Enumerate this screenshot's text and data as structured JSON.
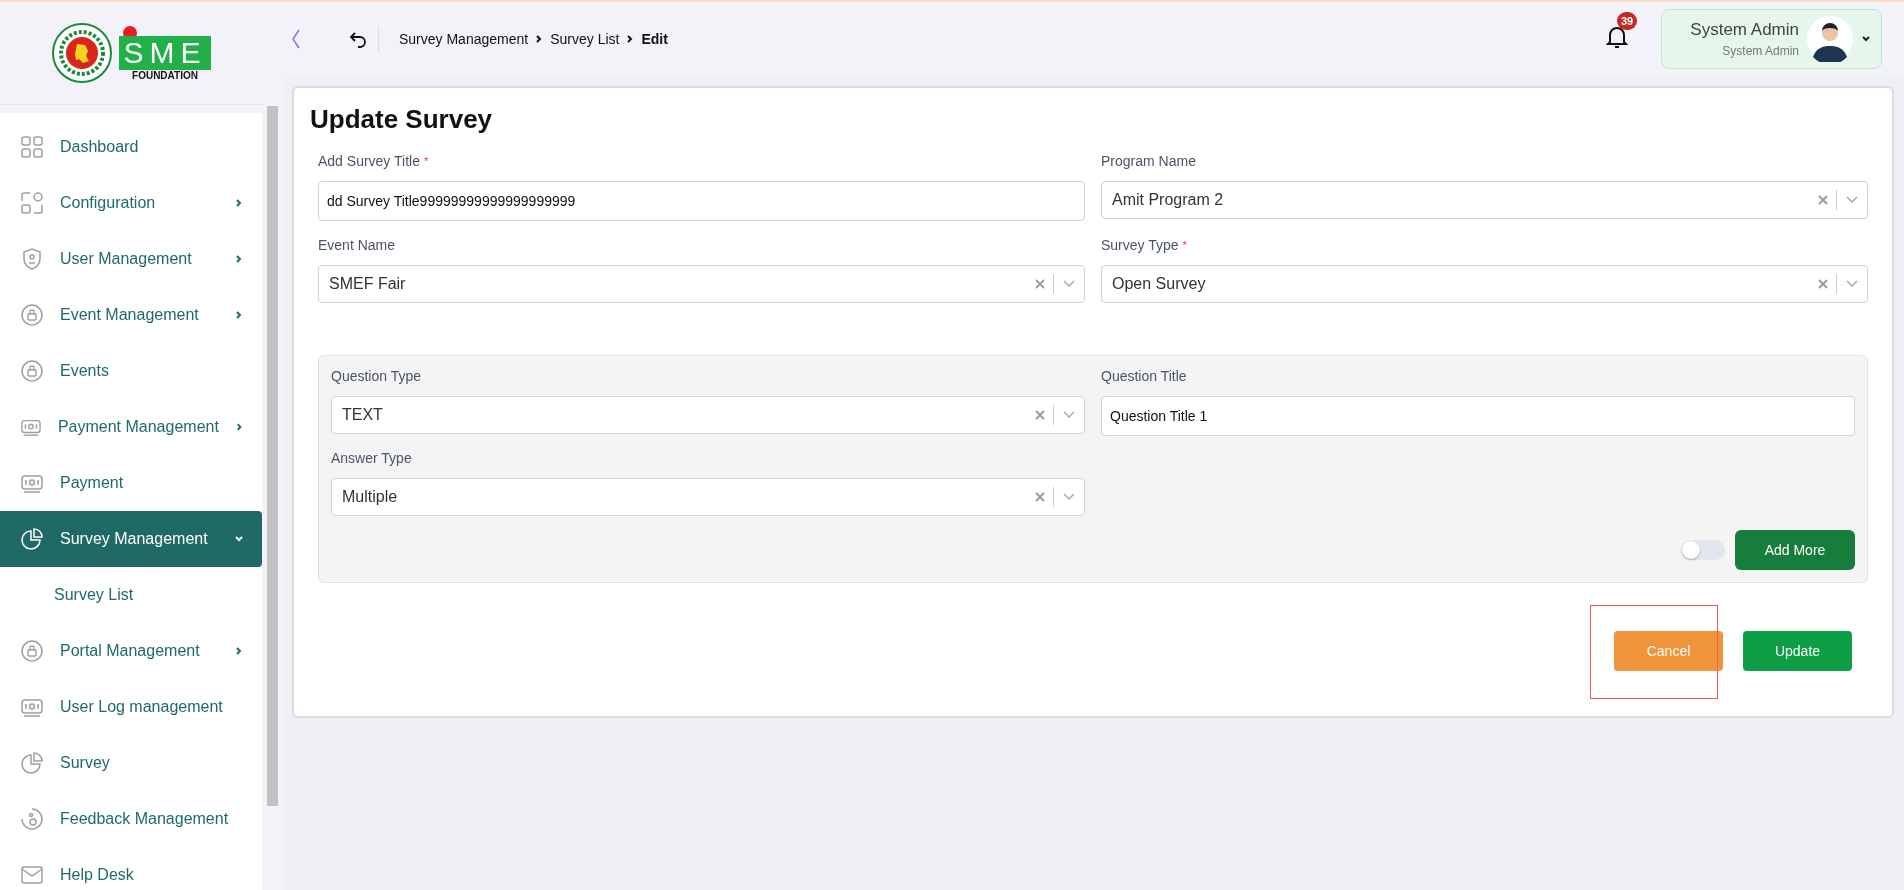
{
  "logo": {
    "brand": "SME",
    "tagline": "FOUNDATION"
  },
  "sidebar": {
    "items": [
      {
        "label": "Dashboard",
        "has_submenu": false,
        "selected": false
      },
      {
        "label": "Configuration",
        "has_submenu": true,
        "selected": false
      },
      {
        "label": "User Management",
        "has_submenu": true,
        "selected": false
      },
      {
        "label": "Event Management",
        "has_submenu": true,
        "selected": false
      },
      {
        "label": "Events",
        "has_submenu": false,
        "selected": false
      },
      {
        "label": "Payment Management",
        "has_submenu": true,
        "selected": false
      },
      {
        "label": "Payment",
        "has_submenu": false,
        "selected": false
      },
      {
        "label": "Survey Management",
        "has_submenu": true,
        "selected": true,
        "expanded": true,
        "children": [
          {
            "label": "Survey List",
            "selected": false
          }
        ]
      },
      {
        "label": "Portal Management",
        "has_submenu": true,
        "selected": false
      },
      {
        "label": "User Log management",
        "has_submenu": false,
        "selected": false
      },
      {
        "label": "Survey",
        "has_submenu": false,
        "selected": false
      },
      {
        "label": "Feedback Management",
        "has_submenu": false,
        "selected": false
      },
      {
        "label": "Help Desk",
        "has_submenu": false,
        "selected": false
      }
    ]
  },
  "header": {
    "breadcrumbs": [
      {
        "label": "Survey Management",
        "current": false
      },
      {
        "label": "Survey List",
        "current": false
      },
      {
        "label": "Edit",
        "current": true
      }
    ],
    "notifications": "39",
    "user": {
      "name": "System Admin",
      "role": "System Admin"
    }
  },
  "form": {
    "title": "Update Survey",
    "fields": [
      {
        "label": "Add Survey Title",
        "required_mark": "*",
        "kind": "text",
        "value": "dd Survey Title99999999999999999999"
      },
      {
        "label": "Program Name",
        "kind": "select",
        "value": "Amit Program 2"
      },
      {
        "label": "Event Name",
        "kind": "select",
        "value": "SMEF Fair"
      },
      {
        "label": "Survey Type",
        "required_mark": "*",
        "kind": "select",
        "value": "Open Survey"
      }
    ],
    "question": {
      "left": [
        {
          "label": "Question Type",
          "kind": "select",
          "value": "TEXT"
        },
        {
          "label": "Answer Type",
          "kind": "select",
          "value": "Multiple"
        }
      ],
      "right": [
        {
          "label": "Question Title",
          "kind": "text",
          "value": "Question Title 1"
        }
      ],
      "toggle": {
        "on": false
      },
      "add_button": "Add More"
    },
    "actions": [
      {
        "label": "Cancel",
        "kind": "cancel",
        "highlighted": true
      },
      {
        "label": "Update",
        "kind": "submit",
        "highlighted": false
      }
    ]
  }
}
